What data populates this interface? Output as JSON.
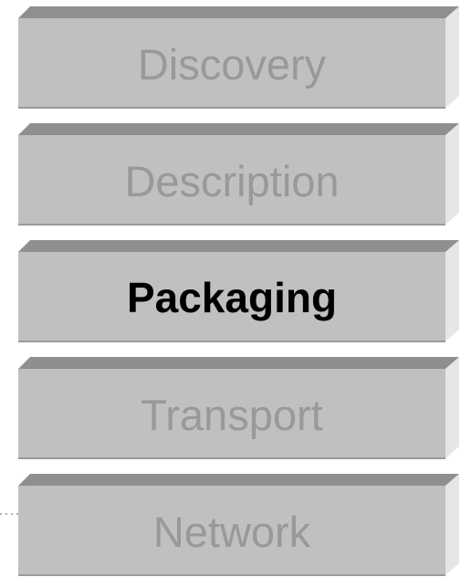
{
  "diagram": {
    "layers": [
      {
        "label": "Discovery",
        "highlighted": false
      },
      {
        "label": "Description",
        "highlighted": false
      },
      {
        "label": "Packaging",
        "highlighted": true
      },
      {
        "label": "Transport",
        "highlighted": false
      },
      {
        "label": "Network",
        "highlighted": false
      }
    ]
  },
  "colors": {
    "face": "#c0c0c0",
    "top": "#8f8f8f",
    "side": "#e6e6e6",
    "inactive_text": "#999999",
    "active_text": "#000000"
  }
}
